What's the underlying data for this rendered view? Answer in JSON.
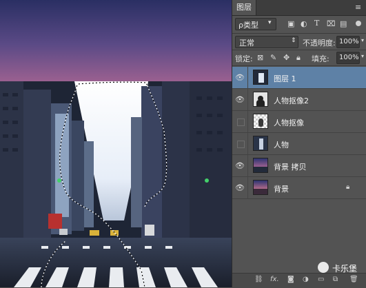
{
  "panel": {
    "tab_label": "图层",
    "filter": {
      "label": "ρ类型",
      "arrow": "▾"
    },
    "blend_mode": "正常",
    "opacity_label": "不透明度:",
    "opacity_value": "100%",
    "lock_label": "锁定:",
    "fill_label": "填充:",
    "fill_value": "100%",
    "layers": [
      {
        "name": "图层 1",
        "visible": true,
        "selected": true,
        "locked": false
      },
      {
        "name": "人物抠像2",
        "visible": true,
        "selected": false,
        "locked": false
      },
      {
        "name": "人物抠像",
        "visible": false,
        "selected": false,
        "locked": false
      },
      {
        "name": "人物",
        "visible": false,
        "selected": false,
        "locked": false
      },
      {
        "name": "背景 拷贝",
        "visible": true,
        "selected": false,
        "locked": false
      },
      {
        "name": "背景",
        "visible": true,
        "selected": false,
        "locked": true
      }
    ],
    "footer_icons": [
      "link-icon",
      "fx-icon",
      "mask-icon",
      "adjustment-icon",
      "group-folder-icon",
      "new-layer-icon",
      "trash-icon"
    ],
    "footer_fx": "fx."
  },
  "watermark": {
    "text": "卡乐堡"
  },
  "colors": {
    "selected_layer": "#5e81a6",
    "panel_bg": "#535353",
    "sky_top": "#2a2f63",
    "sky_bottom": "#8c5a8c"
  }
}
